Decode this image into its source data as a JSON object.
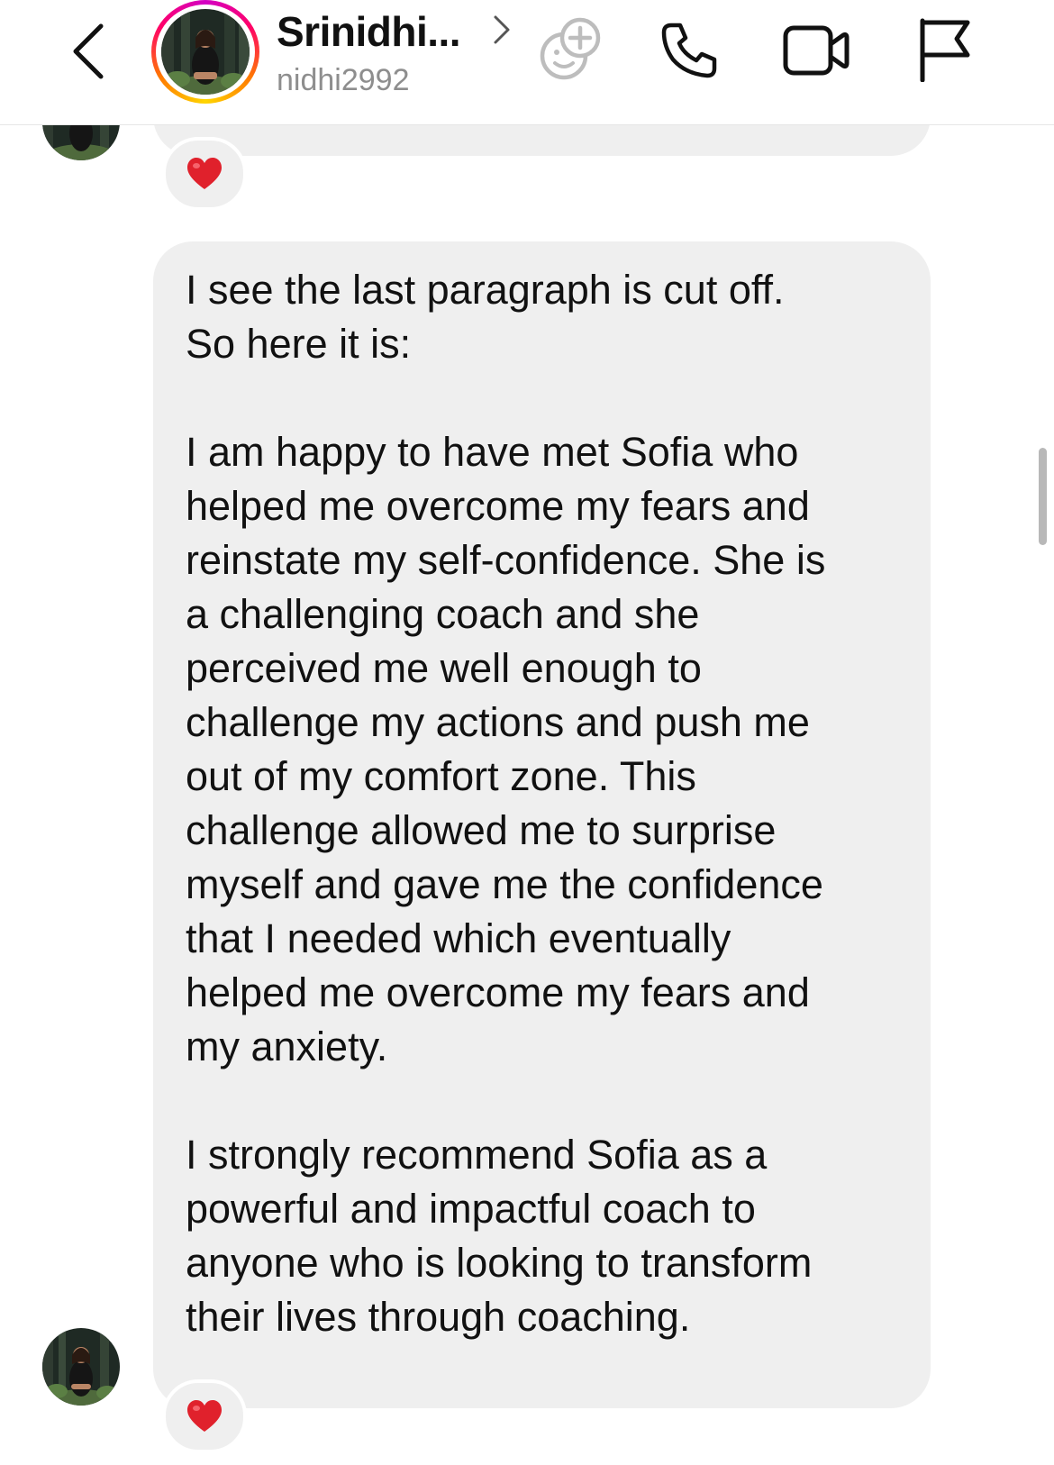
{
  "header": {
    "contact_name": "Srinidhi...",
    "username": "nidhi2992",
    "icons": {
      "back": "chevron-left-icon",
      "title_chevron": "chevron-right-icon",
      "add_person": "add-sticker-face-icon",
      "call": "phone-icon",
      "video": "video-camera-icon",
      "report": "flag-icon"
    }
  },
  "messages": [
    {
      "text": "",
      "reaction": "❤️",
      "truncated_top": true
    },
    {
      "text": "I see the last paragraph is cut off.\nSo here it is:\n\nI am happy to have met Sofia who\nhelped me overcome my fears and\nreinstate my self-confidence. She is\na challenging coach and she\nperceived me well enough to\nchallenge my actions and push me\nout of my comfort zone. This\nchallenge allowed me to surprise\nmyself and gave me the confidence\nthat I needed which eventually\nhelped me overcome my fears and\nmy anxiety.\n\nI strongly recommend Sofia as a\npowerful and impactful coach to\nanyone who is looking to transform\ntheir lives through coaching.",
      "reaction": "❤️"
    }
  ],
  "colors": {
    "bubble": "#efefef",
    "text": "#111111",
    "secondary_text": "#8e8e8e",
    "story_ring": [
      "#d300c5",
      "#ff0069",
      "#ff7a00",
      "#ffd600"
    ]
  }
}
